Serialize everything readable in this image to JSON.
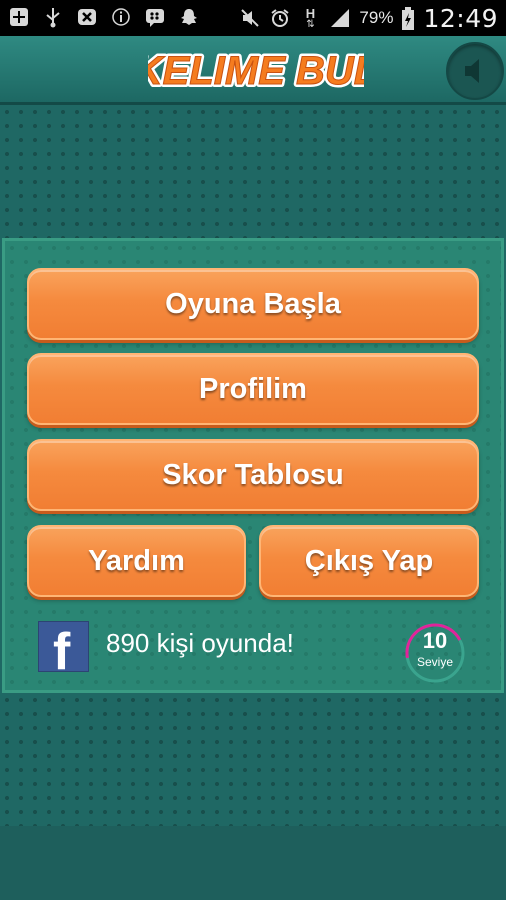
{
  "status_bar": {
    "battery": "79%",
    "time": "12:49",
    "network": "H",
    "icons": [
      "add-icon",
      "usb-icon",
      "debug-icon",
      "info-icon",
      "bbm-icon",
      "snapchat-icon",
      "mute-icon",
      "alarm-icon",
      "network-icon",
      "signal-icon",
      "battery-charging-icon"
    ]
  },
  "header": {
    "logo_text": "KELIME BUL",
    "sound_icon": "speaker-icon"
  },
  "menu": {
    "start": "Oyuna Başla",
    "profile": "Profilim",
    "scoreboard": "Skor Tablosu",
    "help": "Yardım",
    "exit": "Çıkış Yap"
  },
  "footer": {
    "facebook_icon": "facebook-icon",
    "players_online": "890 kişi oyunda!",
    "level_number": "10",
    "level_label": "Seviye",
    "level_progress": 0.45
  },
  "colors": {
    "accent_orange": "#f58a3e",
    "panel_green": "#2a8674",
    "background_teal": "#1f6864",
    "level_ring": "#e0249a"
  }
}
